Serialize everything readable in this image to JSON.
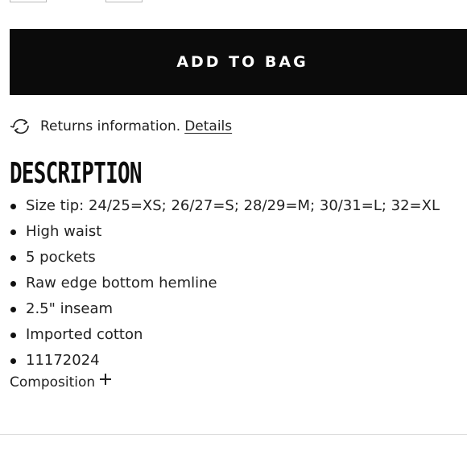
{
  "product": {
    "add_to_bag_label": "ADD TO BAG",
    "returns_text": "Returns information.",
    "returns_link": "Details"
  },
  "description": {
    "title": "DESCRIPTION",
    "items": [
      "Size tip: 24/25=XS; 26/27=S; 28/29=M; 30/31=L; 32=XL",
      "High waist",
      "5 pockets",
      "Raw edge bottom hemline",
      "2.5\" inseam",
      "Imported cotton",
      "11172024"
    ]
  },
  "composition": {
    "label": "Composition"
  },
  "icons": {
    "returns": "refresh-arrows-icon",
    "expand": "plus-icon"
  },
  "colors": {
    "button_bg": "#0b0b0b",
    "button_text": "#ffffff",
    "text": "#222222"
  }
}
